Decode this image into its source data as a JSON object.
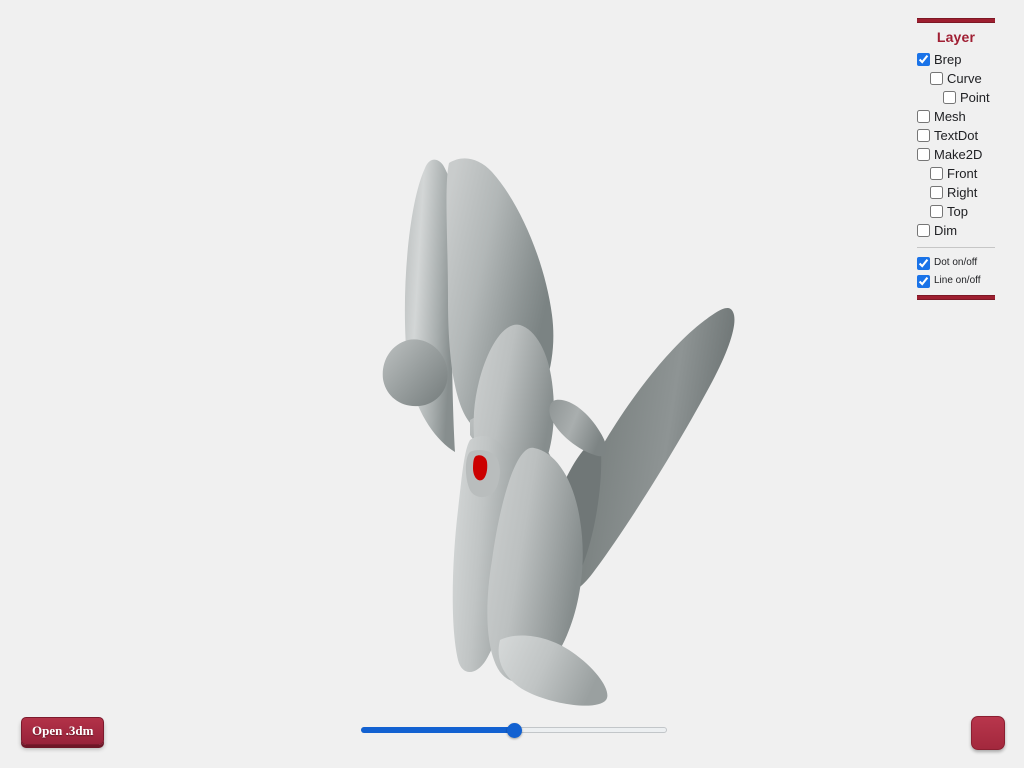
{
  "app": {
    "background_color": "#f0f0f0",
    "accent_color": "#9e1f30",
    "checkbox_color": "#1a73e8"
  },
  "viewport": {
    "name": "3d-model-viewport",
    "model_description": "Shaded gray NURBS surface model of an organic, anchor-like multi-bladed form",
    "shading": "smooth-shaded",
    "material_light": "#d2d5d5",
    "material_mid": "#9aa0a0",
    "material_dark": "#72797a",
    "highlight_color": "#cc0000"
  },
  "layer_panel": {
    "title": "Layer",
    "layers": [
      {
        "label": "Brep",
        "checked": true,
        "indent": 0
      },
      {
        "label": "Curve",
        "checked": false,
        "indent": 1
      },
      {
        "label": "Point",
        "checked": false,
        "indent": 2
      },
      {
        "label": "Mesh",
        "checked": false,
        "indent": 0
      },
      {
        "label": "TextDot",
        "checked": false,
        "indent": 0
      },
      {
        "label": "Make2D",
        "checked": false,
        "indent": 0
      },
      {
        "label": "Front",
        "checked": false,
        "indent": 1
      },
      {
        "label": "Right",
        "checked": false,
        "indent": 1
      },
      {
        "label": "Top",
        "checked": false,
        "indent": 1
      },
      {
        "label": "Dim",
        "checked": false,
        "indent": 0
      }
    ],
    "toggles": [
      {
        "label": "Dot on/off",
        "checked": true
      },
      {
        "label": "Line on/off",
        "checked": true
      }
    ]
  },
  "controls": {
    "open_button_label": "Open .3dm",
    "slider": {
      "name": "view-slider",
      "value_percent": 50,
      "min": 0,
      "max": 100
    },
    "corner_button_label": ""
  }
}
